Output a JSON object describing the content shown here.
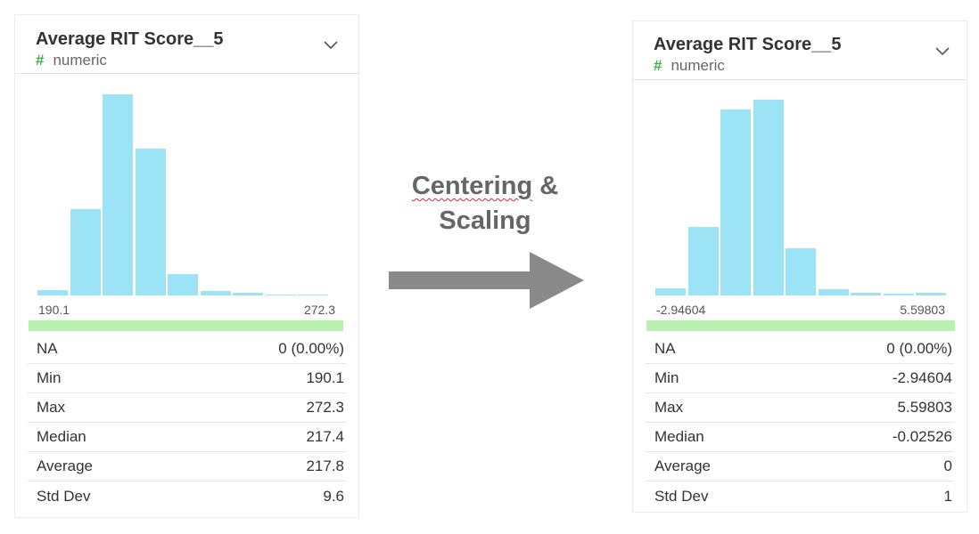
{
  "transform": {
    "line1_word": "Centering",
    "line1_rest": " &",
    "line2": "Scaling"
  },
  "left_card": {
    "title": "Average RIT Score__5",
    "type_icon": "#",
    "type_label": "numeric",
    "axis_min": "190.1",
    "axis_max": "272.3",
    "stats": [
      {
        "label": "NA",
        "value": "0 (0.00%)"
      },
      {
        "label": "Min",
        "value": "190.1"
      },
      {
        "label": "Max",
        "value": "272.3"
      },
      {
        "label": "Median",
        "value": "217.4"
      },
      {
        "label": "Average",
        "value": "217.8"
      },
      {
        "label": "Std Dev",
        "value": "9.6"
      }
    ]
  },
  "right_card": {
    "title": "Average RIT Score__5",
    "type_icon": "#",
    "type_label": "numeric",
    "axis_min": "-2.94604",
    "axis_max": "5.59803",
    "stats": [
      {
        "label": "NA",
        "value": "0 (0.00%)"
      },
      {
        "label": "Min",
        "value": "-2.94604"
      },
      {
        "label": "Max",
        "value": "5.59803"
      },
      {
        "label": "Median",
        "value": "-0.02526"
      },
      {
        "label": "Average",
        "value": "0"
      },
      {
        "label": "Std Dev",
        "value": "1"
      }
    ]
  },
  "colors": {
    "bar": "#9be3f5",
    "valid_bar": "#b8f1b0",
    "hash": "#43b04a",
    "arrow": "#8a8a8a"
  },
  "chart_data": [
    {
      "type": "bar",
      "title": "",
      "xlim": [
        190.1,
        272.3
      ],
      "categories": [
        "1",
        "2",
        "3",
        "4",
        "5",
        "6",
        "7",
        "8",
        "9"
      ],
      "values": [
        2.5,
        43,
        100,
        73,
        10.5,
        2.3,
        1.3,
        0.6,
        0.6
      ]
    },
    {
      "type": "bar",
      "title": "",
      "xlim": [
        -2.94604,
        5.59803
      ],
      "categories": [
        "1",
        "2",
        "3",
        "4",
        "5",
        "6",
        "7",
        "8",
        "9"
      ],
      "values": [
        3.6,
        35,
        95,
        100,
        24,
        3.2,
        1.3,
        0.8,
        1.5
      ]
    }
  ]
}
